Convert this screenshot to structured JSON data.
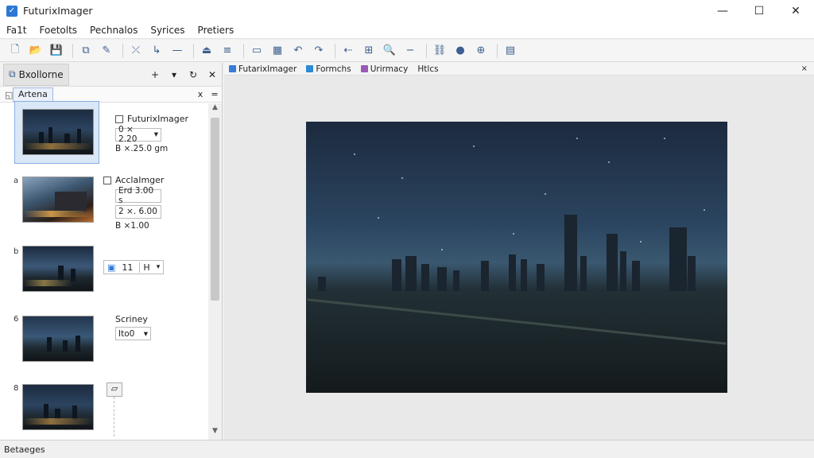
{
  "window": {
    "title": "FuturixImager",
    "minimize": "—",
    "maximize": "☐",
    "close": "✕"
  },
  "menu": [
    "Fa1t",
    "Foetolts",
    "Pechnalos",
    "Syrices",
    "Pretiers"
  ],
  "toolbar_icons": [
    "new-icon",
    "open-icon",
    "save-icon",
    "sep",
    "copy-icon",
    "edit-icon",
    "sep",
    "crop-icon",
    "cursor-icon",
    "minus-icon",
    "sep",
    "up-icon",
    "lines-icon",
    "sep",
    "panel-icon",
    "palette-icon",
    "undo-icon",
    "redo-icon",
    "sep",
    "back-icon",
    "grid-icon",
    "zoom-icon",
    "minus-line-icon",
    "sep",
    "link-icon",
    "dot-icon",
    "zoom-fit-icon",
    "sep",
    "layout-icon"
  ],
  "left_panel": {
    "tab_label": "Bxollorne",
    "controls": [
      "+",
      "▾",
      "↻",
      "✕"
    ],
    "subtab_label": "Artena",
    "subtab_controls": [
      "x",
      "="
    ],
    "items": [
      {
        "num": "",
        "title": "FuturixImager",
        "dd1": "0 × 2.20",
        "txt1": "B ×.25.0 gm"
      },
      {
        "num": "a",
        "title": "AcclaImger",
        "dd1": "Erd 3.00 s",
        "txt1": "2 ×. 6.00",
        "txt2": "B ×1.00"
      },
      {
        "num": "b",
        "spin_val": "11",
        "spin_unit": "H"
      },
      {
        "num": "6",
        "title": "Scriney",
        "dd1": "Ito0"
      },
      {
        "num": "8"
      }
    ]
  },
  "doc_tabs": [
    {
      "label": "FutarixImager",
      "color": "#3a7bd5"
    },
    {
      "label": "Formchs",
      "color": "#2a8ad8"
    },
    {
      "label": "Urirmacy",
      "color": "#9b59b6"
    },
    {
      "label": "Htlcs",
      "color": ""
    }
  ],
  "doc_close": "×",
  "status": {
    "text": "Betaeges"
  }
}
